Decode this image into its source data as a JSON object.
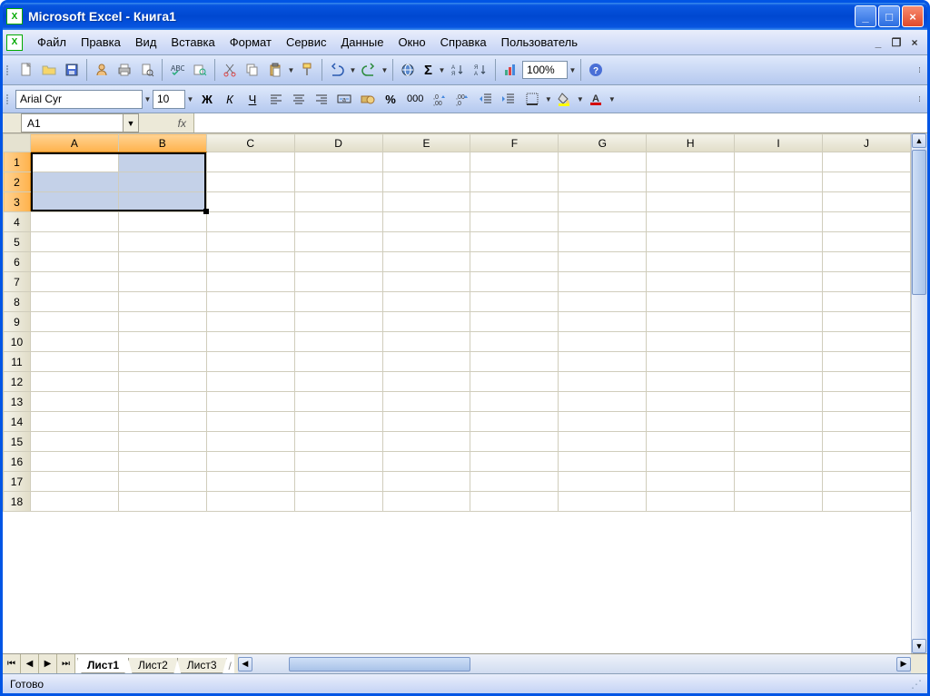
{
  "titlebar": {
    "title": "Microsoft Excel - Книга1"
  },
  "menu": {
    "items": [
      "Файл",
      "Правка",
      "Вид",
      "Вставка",
      "Формат",
      "Сервис",
      "Данные",
      "Окно",
      "Справка",
      "Пользователь"
    ]
  },
  "toolbar": {
    "zoom": "100%"
  },
  "formatbar": {
    "font": "Arial Cyr",
    "size": "10",
    "bold": "Ж",
    "italic": "К",
    "underline": "Ч",
    "percent": "%",
    "thousand": "000"
  },
  "formula": {
    "namebox": "A1",
    "fx": "fx",
    "value": ""
  },
  "grid": {
    "cols": [
      "A",
      "B",
      "C",
      "D",
      "E",
      "F",
      "G",
      "H",
      "I",
      "J"
    ],
    "rows": [
      "1",
      "2",
      "3",
      "4",
      "5",
      "6",
      "7",
      "8",
      "9",
      "10",
      "11",
      "12",
      "13",
      "14",
      "15",
      "16",
      "17",
      "18"
    ],
    "selectedCols": [
      "A",
      "B"
    ],
    "selectedRows": [
      "1",
      "2",
      "3"
    ],
    "activeCell": "A1"
  },
  "sheetTabs": {
    "tabs": [
      "Лист1",
      "Лист2",
      "Лист3"
    ],
    "active": "Лист1"
  },
  "status": {
    "text": "Готово"
  }
}
